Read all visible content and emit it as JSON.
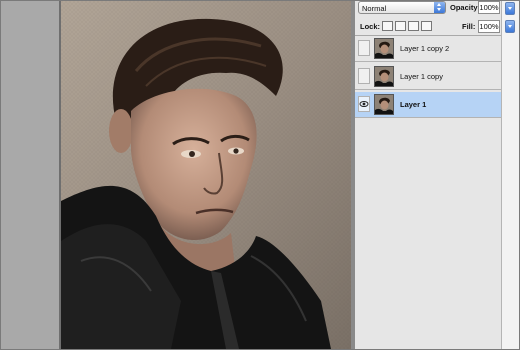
{
  "layers_panel": {
    "blend_mode": "Normal",
    "opacity_label": "Opacity:",
    "opacity_value": "100%",
    "lock_label": "Lock:",
    "fill_label": "Fill:",
    "fill_value": "100%",
    "layers": [
      {
        "name": "Layer 1 copy 2",
        "visible": false,
        "selected": false
      },
      {
        "name": "Layer 1 copy",
        "visible": false,
        "selected": false
      },
      {
        "name": "Layer 1",
        "visible": true,
        "selected": true
      }
    ]
  },
  "colors": {
    "selection": "#b6d3f5",
    "accent_blue": "#3c78d8"
  }
}
